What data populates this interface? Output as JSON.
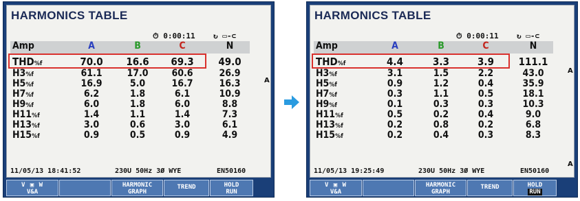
{
  "title": "HARMONICS TABLE",
  "column_headers": {
    "label": "Amp",
    "a": "A",
    "b": "B",
    "c": "C",
    "n": "N"
  },
  "colors": {
    "phase_a": "#2a3fbf",
    "phase_b": "#2a9a2a",
    "phase_c": "#c4261e",
    "highlight": "#d9302c",
    "arrow": "#2a9be0"
  },
  "status_icons": "clock-icon, battery-plug-icon",
  "softkeys": {
    "va": "V&A",
    "harmonic_graph_1": "HARMONIC",
    "harmonic_graph_2": "GRAPH",
    "trend": "TREND",
    "hold": "HOLD",
    "run": "RUN"
  },
  "screens": {
    "before": {
      "elapsed": "0:00:11",
      "rows": [
        {
          "label": "THD",
          "sub": "%f",
          "a": "70.0",
          "b": "16.6",
          "c": "69.3",
          "n": "49.0"
        },
        {
          "label": "H3",
          "sub": "%f",
          "a": "61.1",
          "b": "17.0",
          "c": "60.6",
          "n": "26.9"
        },
        {
          "label": "H5",
          "sub": "%f",
          "a": "16.9",
          "b": "5.0",
          "c": "16.7",
          "n": "16.3"
        },
        {
          "label": "H7",
          "sub": "%f",
          "a": "6.2",
          "b": "1.8",
          "c": "6.1",
          "n": "10.9"
        },
        {
          "label": "H9",
          "sub": "%f",
          "a": "6.0",
          "b": "1.8",
          "c": "6.0",
          "n": "8.8"
        },
        {
          "label": "H11",
          "sub": "%f",
          "a": "1.4",
          "b": "1.1",
          "c": "1.4",
          "n": "7.3"
        },
        {
          "label": "H13",
          "sub": "%f",
          "a": "3.0",
          "b": "0.6",
          "c": "3.0",
          "n": "6.1"
        },
        {
          "label": "H15",
          "sub": "%f",
          "a": "0.9",
          "b": "0.5",
          "c": "0.9",
          "n": "4.9"
        }
      ],
      "date_time": "11/05/13 18:41:52",
      "config": "230U 50Hz 3Ø WYE",
      "instrument_id": "EN50160"
    },
    "after": {
      "elapsed": "0:00:11",
      "rows": [
        {
          "label": "THD",
          "sub": "%f",
          "a": "4.4",
          "b": "3.3",
          "c": "3.9",
          "n": "111.1"
        },
        {
          "label": "H3",
          "sub": "%f",
          "a": "3.1",
          "b": "1.5",
          "c": "2.2",
          "n": "43.0"
        },
        {
          "label": "H5",
          "sub": "%f",
          "a": "0.9",
          "b": "1.2",
          "c": "0.4",
          "n": "35.9"
        },
        {
          "label": "H7",
          "sub": "%f",
          "a": "0.3",
          "b": "1.1",
          "c": "0.5",
          "n": "18.1"
        },
        {
          "label": "H9",
          "sub": "%f",
          "a": "0.1",
          "b": "0.3",
          "c": "0.3",
          "n": "10.3"
        },
        {
          "label": "H11",
          "sub": "%f",
          "a": "0.5",
          "b": "0.2",
          "c": "0.4",
          "n": "9.0"
        },
        {
          "label": "H13",
          "sub": "%f",
          "a": "0.2",
          "b": "0.8",
          "c": "0.2",
          "n": "6.8"
        },
        {
          "label": "H15",
          "sub": "%f",
          "a": "0.2",
          "b": "0.4",
          "c": "0.3",
          "n": "8.3"
        }
      ],
      "date_time": "11/05/13 19:25:49",
      "config": "230U 50Hz 3Ø WYE",
      "instrument_id": "EN50160"
    }
  }
}
